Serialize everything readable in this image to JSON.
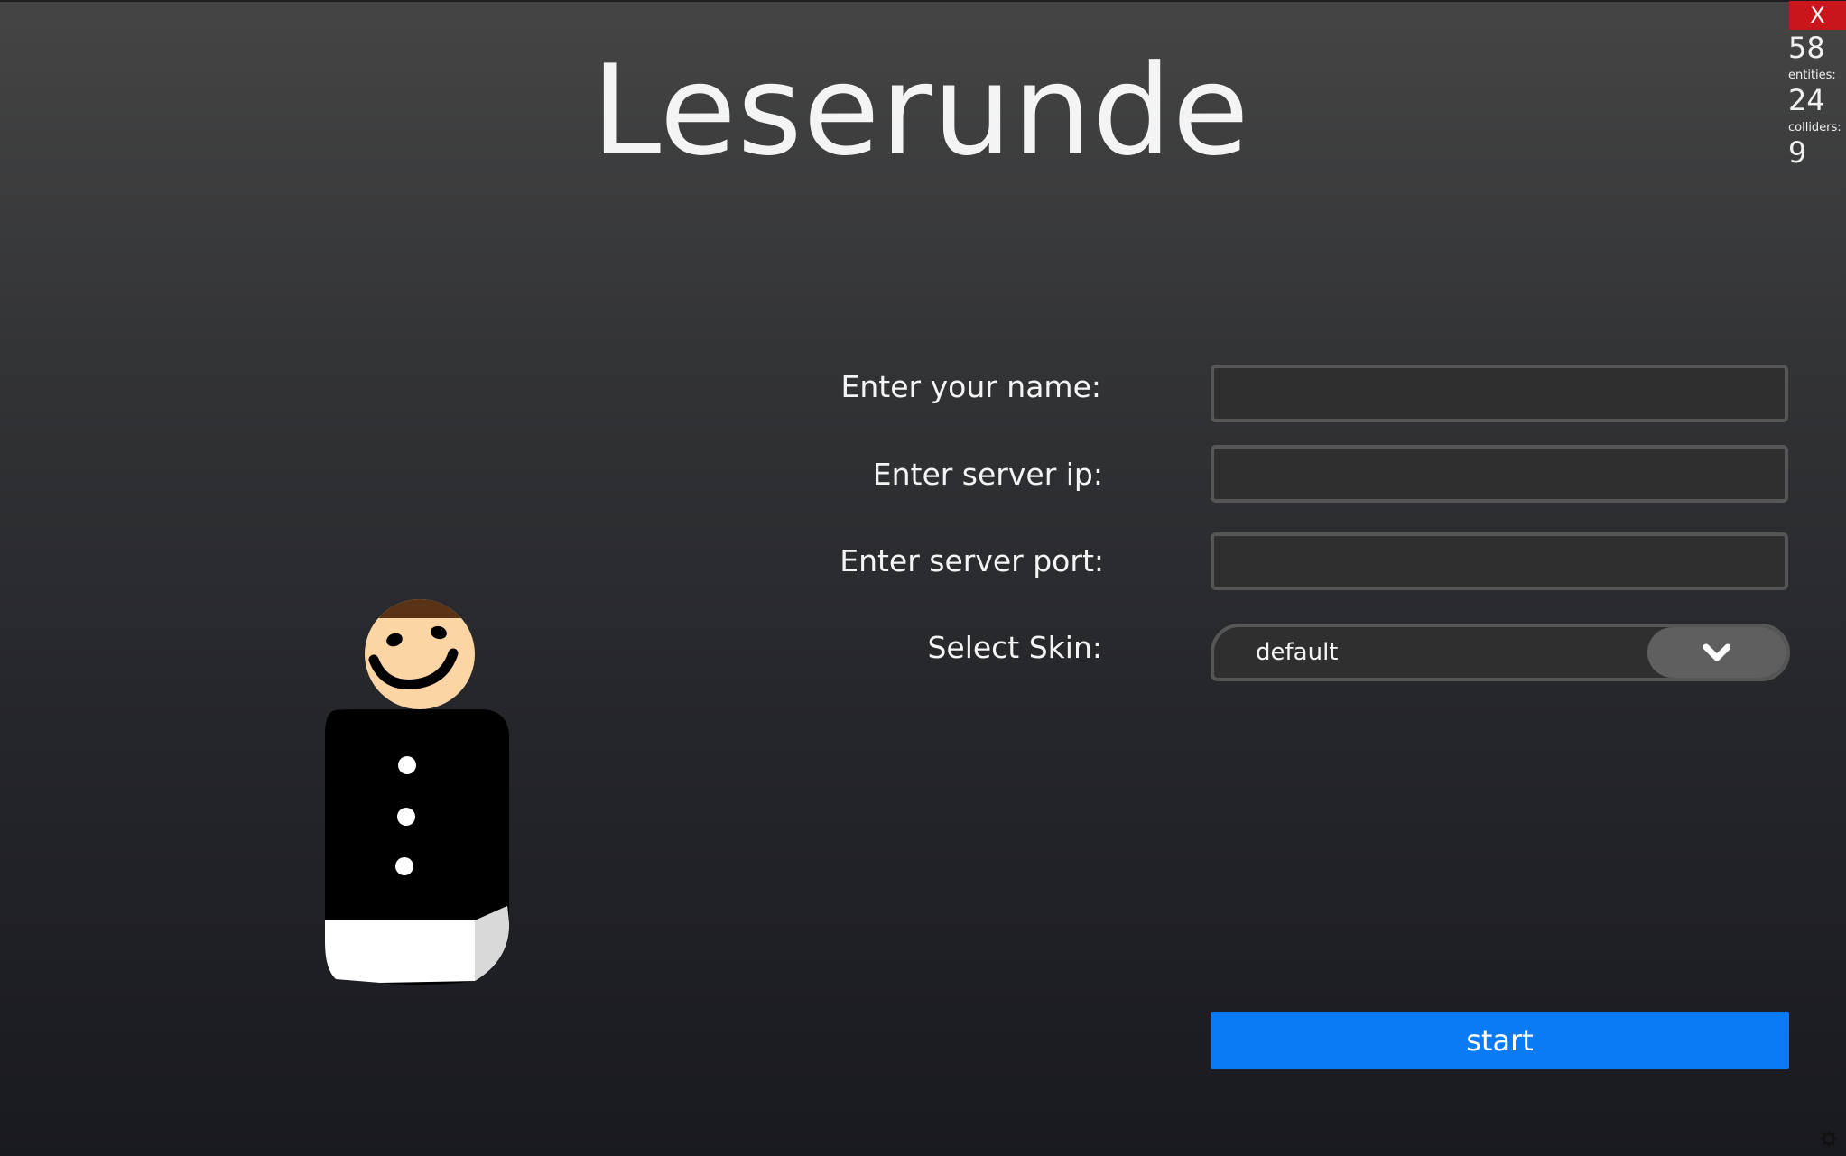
{
  "app": {
    "title": "Leserunde"
  },
  "window": {
    "close_label": "X"
  },
  "stats": {
    "fps": "58",
    "entities_label": "entities:",
    "entities": "24",
    "colliders_label": "colliders:",
    "colliders": "9"
  },
  "form": {
    "name_label": "Enter your name:",
    "name_value": "",
    "ip_label": "Enter server ip:",
    "ip_value": "",
    "port_label": "Enter server port:",
    "port_value": "",
    "skin_label": "Select Skin:",
    "skin_selected": "default",
    "start_label": "start"
  },
  "preview": {
    "character": "player-character-preview"
  },
  "icons": {
    "dropdown": "chevron-down-icon",
    "settings": "gear-icon"
  },
  "colors": {
    "accent": "#0a7bf5",
    "close": "#c8161c",
    "background_top": "#454545",
    "background_bottom": "#191a20"
  }
}
